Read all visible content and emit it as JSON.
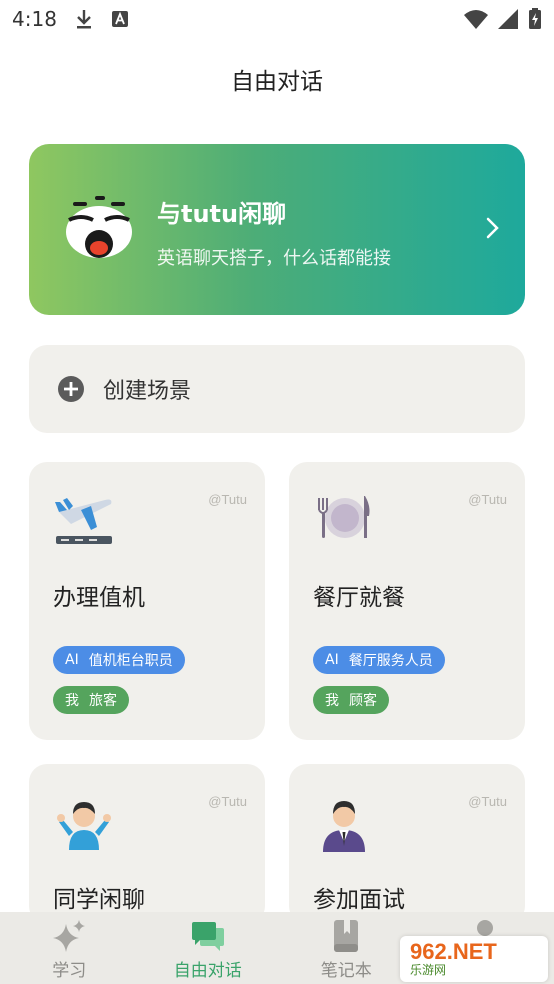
{
  "status_bar": {
    "time": "4:18"
  },
  "header": {
    "title": "自由对话"
  },
  "chat_banner": {
    "title": "与tutu闲聊",
    "subtitle": "英语聊天搭子，什么话都能接"
  },
  "create_scene": {
    "label": "创建场景"
  },
  "scenes": [
    {
      "title": "办理值机",
      "watermark": "@Tutu",
      "ai_tag": "AI",
      "ai_role": "值机柜台职员",
      "me_tag": "我",
      "me_role": "旅客",
      "icon": "airplane-icon"
    },
    {
      "title": "餐厅就餐",
      "watermark": "@Tutu",
      "ai_tag": "AI",
      "ai_role": "餐厅服务人员",
      "me_tag": "我",
      "me_role": "顾客",
      "icon": "plate-icon"
    },
    {
      "title": "同学闲聊",
      "watermark": "@Tutu",
      "icon": "student-icon"
    },
    {
      "title": "参加面试",
      "watermark": "@Tutu",
      "icon": "interviewer-icon"
    }
  ],
  "tab_bar": {
    "tabs": [
      {
        "label": "学习",
        "icon": "sparkle-icon"
      },
      {
        "label": "自由对话",
        "icon": "chat-bubbles-icon"
      },
      {
        "label": "笔记本",
        "icon": "notebook-icon"
      }
    ],
    "active_color": "#3aa36a"
  },
  "watermark_badge": {
    "logo": "962.NET",
    "sub": "乐游网"
  }
}
